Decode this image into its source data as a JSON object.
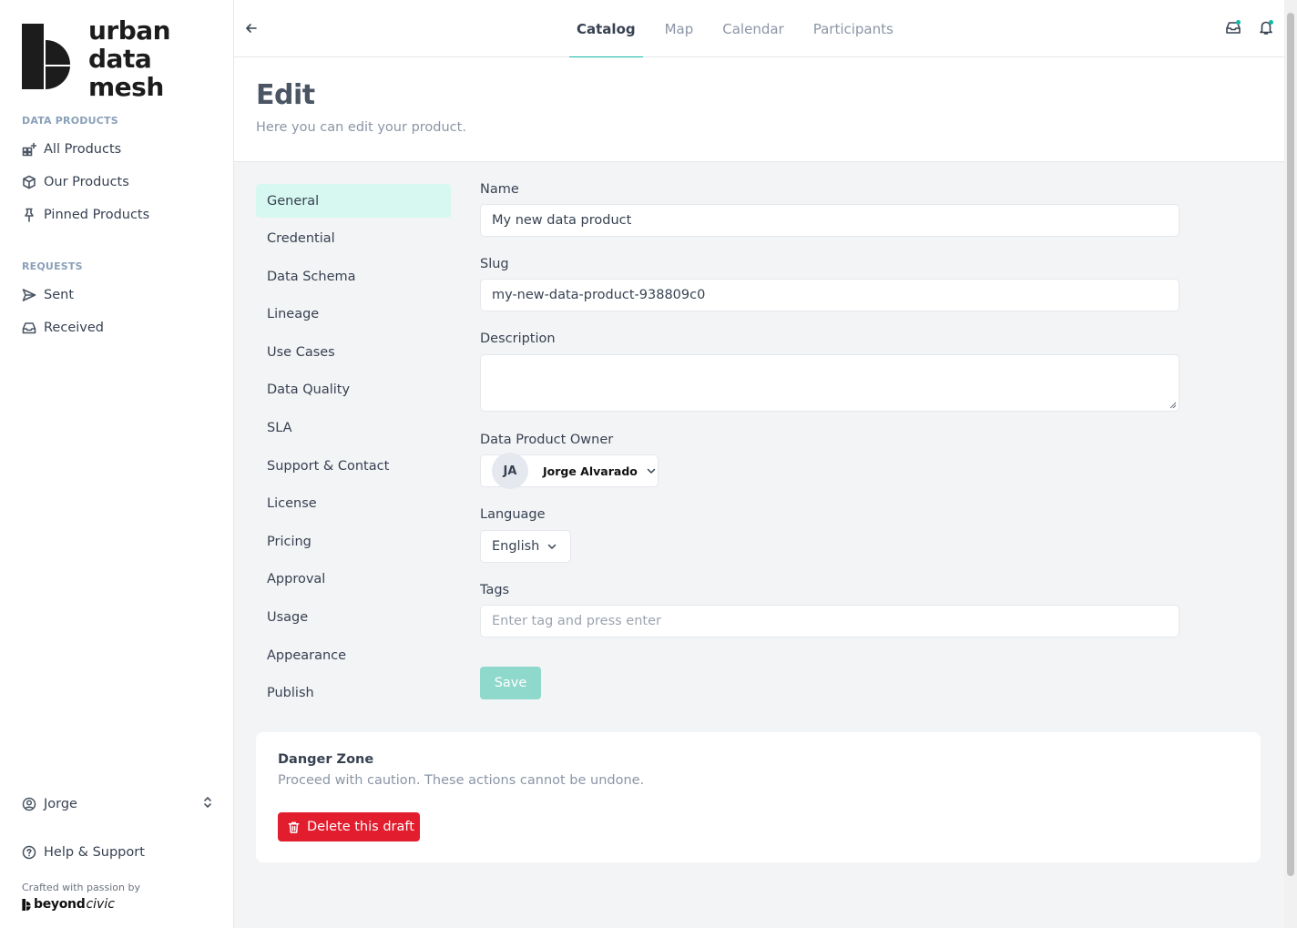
{
  "brand": {
    "logo_lines": [
      "urban",
      "data",
      "mesh"
    ],
    "credit": "Crafted with passion by",
    "maker_bold": "beyond",
    "maker_italic": "civic"
  },
  "sidebar": {
    "section_data_products": "DATA PRODUCTS",
    "data_products": [
      {
        "label": "All Products",
        "icon": "grid-plus-icon"
      },
      {
        "label": "Our Products",
        "icon": "box-icon"
      },
      {
        "label": "Pinned Products",
        "icon": "pin-icon"
      }
    ],
    "section_requests": "REQUESTS",
    "requests": [
      {
        "label": "Sent",
        "icon": "send-icon"
      },
      {
        "label": "Received",
        "icon": "inbox-icon"
      }
    ],
    "user": "Jorge",
    "help": "Help & Support"
  },
  "topbar": {
    "tabs": [
      "Catalog",
      "Map",
      "Calendar",
      "Participants"
    ],
    "active_tab": "Catalog"
  },
  "header": {
    "title": "Edit",
    "subtitle": "Here you can edit your product."
  },
  "subnav": {
    "items": [
      "General",
      "Credential",
      "Data Schema",
      "Lineage",
      "Use Cases",
      "Data Quality",
      "SLA",
      "Support & Contact",
      "License",
      "Pricing",
      "Approval",
      "Usage",
      "Appearance",
      "Publish"
    ],
    "active": "General"
  },
  "form": {
    "name_label": "Name",
    "name_value": "My new data product",
    "slug_label": "Slug",
    "slug_value": "my-new-data-product-938809c0",
    "description_label": "Description",
    "description_value": "",
    "owner_label": "Data Product Owner",
    "owner_initials": "JA",
    "owner_name": "Jorge Alvarado",
    "language_label": "Language",
    "language_value": "English",
    "tags_label": "Tags",
    "tags_placeholder": "Enter tag and press enter",
    "save_label": "Save"
  },
  "danger": {
    "title": "Danger Zone",
    "subtitle": "Proceed with caution. These actions cannot be undone.",
    "delete_label": "Delete this draft"
  },
  "colors": {
    "accent": "#14b8a6",
    "active_bg": "#d7f8f1",
    "save_bg": "#8fd8cc",
    "danger": "#e11d2e"
  }
}
